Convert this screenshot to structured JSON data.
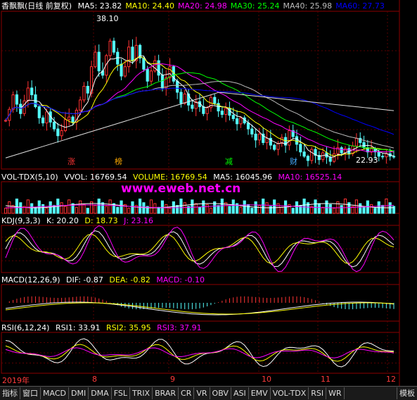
{
  "chart_data": {
    "type": "line",
    "title": "香飘飘(日线 前复权)",
    "main": {
      "ma_legend": [
        {
          "label": "MA5: 23.82",
          "color": "#ffffff"
        },
        {
          "label": "MA10: 24.40",
          "color": "#ffff00"
        },
        {
          "label": "MA20: 24.98",
          "color": "#ff00ff"
        },
        {
          "label": "MA30: 25.24",
          "color": "#00ff00"
        },
        {
          "label": "MA40: 25.98",
          "color": "#bbbbbb"
        },
        {
          "label": "MA60: 27.73",
          "color": "#0000ff"
        }
      ],
      "high_label": "38.10",
      "low_label": "22.93",
      "markers": [
        {
          "text": "涨",
          "color": "#ff3333"
        },
        {
          "text": "榜",
          "color": "#ffaa00"
        },
        {
          "text": "减",
          "color": "#00ff00"
        },
        {
          "text": "财",
          "color": "#44aaff"
        }
      ],
      "close": [
        27.2,
        28.5,
        30.2,
        29.1,
        28.0,
        29.5,
        31.0,
        30.2,
        28.8,
        27.5,
        26.9,
        28.2,
        27.0,
        26.2,
        25.4,
        26.0,
        27.3,
        27.6,
        27.0,
        28.4,
        29.6,
        31.2,
        30.4,
        33.5,
        35.2,
        33.0,
        32.5,
        34.8,
        36.5,
        35.2,
        33.8,
        32.4,
        33.5,
        35.8,
        34.2,
        36.0,
        34.5,
        33.2,
        31.8,
        33.0,
        34.2,
        32.5,
        31.0,
        32.2,
        33.5,
        31.8,
        30.5,
        29.2,
        30.3,
        29.0,
        28.6,
        29.4,
        28.8,
        28.0,
        28.7,
        29.9,
        29.2,
        28.3,
        27.9,
        28.6,
        27.8,
        27.4,
        26.8,
        27.5,
        26.9,
        26.2,
        25.6,
        24.9,
        25.6,
        24.6,
        25.1,
        24.3,
        23.8,
        24.5,
        25.2,
        24.3,
        26.0,
        25.3,
        24.4,
        23.5,
        23.0,
        22.5,
        23.8,
        23.1,
        22.6,
        23.4,
        22.9,
        22.4,
        23.3,
        24.0,
        23.4,
        23.9,
        23.3,
        24.2,
        25.1,
        24.6,
        24.0,
        23.5,
        23.9,
        23.5,
        23.0,
        22.93,
        23.3,
        23.0,
        22.9
      ],
      "ylim": [
        21.5,
        39.5
      ]
    },
    "volume": {
      "name": "VOL-TDX(5,10)",
      "values_text": {
        "vvol": "VVOL: 16769.54",
        "volume": "VOLUME: 16769.54",
        "ma5": "MA5: 16045.96",
        "ma10": "MA10: 16525.14"
      },
      "watermark": "www.eweb.net.cn"
    },
    "kdj": {
      "name": "KDJ(9,3,3)",
      "k": "K: 20.20",
      "d": "D: 18.73",
      "j": "J: 23.16"
    },
    "macd": {
      "name": "MACD(12,26,9)",
      "dif": "DIF: -0.87",
      "dea": "DEA: -0.82",
      "macd": "MACD: -0.10"
    },
    "rsi": {
      "name": "RSI(6,12,24)",
      "rsi1": "RSI1: 33.91",
      "rsi2": "RSI2: 35.95",
      "rsi3": "RSI3: 37.91"
    },
    "date_axis": [
      "2019年",
      "8",
      "9",
      "10",
      "11",
      "12"
    ]
  },
  "tabs": [
    "指标",
    "窗口",
    "MACD",
    "DMI",
    "DMA",
    "FSL",
    "TRIX",
    "BRAR",
    "CR",
    "VR",
    "OBV",
    "ASI",
    "EMV",
    "VOL-TDX",
    "RSI",
    "WR"
  ],
  "tab_right": "模板",
  "colors": {
    "up": "#ff3333",
    "down": "#54fcfc",
    "grid": "#8b0000",
    "bg": "#000000"
  }
}
